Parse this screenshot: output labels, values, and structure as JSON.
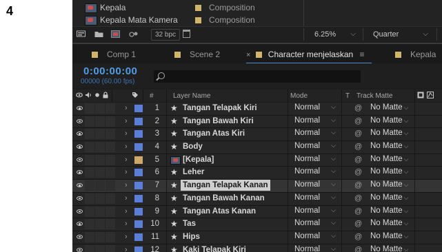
{
  "step_number": "4",
  "project": {
    "items": [
      {
        "name": "Kepala",
        "type": "Composition"
      },
      {
        "name": "Kepala Mata Kamera",
        "type": "Composition"
      }
    ],
    "bpc": "32 bpc",
    "zoom": "6.25%",
    "quality": "Quarter"
  },
  "tabs": [
    {
      "label": "Comp 1",
      "active": false
    },
    {
      "label": "Scene 2",
      "active": false
    },
    {
      "label": "Character menjelaskan",
      "active": true
    },
    {
      "label": "Kepala",
      "active": false
    }
  ],
  "timeline": {
    "timecode": "0:00:00:00",
    "frames": "00000 (60.00 fps)"
  },
  "columns": {
    "hash": "#",
    "layer_name": "Layer Name",
    "mode": "Mode",
    "t": "T",
    "track_matte": "Track Matte"
  },
  "layers": [
    {
      "num": "1",
      "name": "Tangan Telapak Kiri",
      "mode": "Normal",
      "matte": "No Matte",
      "kind": "shape",
      "label_color": "blue",
      "selected": false
    },
    {
      "num": "2",
      "name": "Tangan Bawah Kiri",
      "mode": "Normal",
      "matte": "No Matte",
      "kind": "shape",
      "label_color": "blue",
      "selected": false
    },
    {
      "num": "3",
      "name": "Tangan Atas Kiri",
      "mode": "Normal",
      "matte": "No Matte",
      "kind": "shape",
      "label_color": "blue",
      "selected": false
    },
    {
      "num": "4",
      "name": "Body",
      "mode": "Normal",
      "matte": "No Matte",
      "kind": "shape",
      "label_color": "blue",
      "selected": false
    },
    {
      "num": "5",
      "name": "[Kepala]",
      "mode": "Normal",
      "matte": "No Matte",
      "kind": "precomp",
      "label_color": "tan",
      "selected": false
    },
    {
      "num": "6",
      "name": "Leher",
      "mode": "Normal",
      "matte": "No Matte",
      "kind": "shape",
      "label_color": "blue",
      "selected": false
    },
    {
      "num": "7",
      "name": "Tangan Telapak Kanan",
      "mode": "Normal",
      "matte": "No Matte",
      "kind": "shape",
      "label_color": "blue",
      "selected": true
    },
    {
      "num": "8",
      "name": "Tangan Bawah Kanan",
      "mode": "Normal",
      "matte": "No Matte",
      "kind": "shape",
      "label_color": "blue",
      "selected": false
    },
    {
      "num": "9",
      "name": "Tangan Atas Kanan",
      "mode": "Normal",
      "matte": "No Matte",
      "kind": "shape",
      "label_color": "blue",
      "selected": false
    },
    {
      "num": "10",
      "name": "Tas",
      "mode": "Normal",
      "matte": "No Matte",
      "kind": "shape",
      "label_color": "blue",
      "selected": false
    },
    {
      "num": "11",
      "name": "Hips",
      "mode": "Normal",
      "matte": "No Matte",
      "kind": "shape",
      "label_color": "blue",
      "selected": false
    },
    {
      "num": "12",
      "name": "Kaki Telapak Kiri",
      "mode": "Normal",
      "matte": "No Matte",
      "kind": "shape",
      "label_color": "blue",
      "selected": false
    }
  ],
  "colors": {
    "accent_blue": "#4f9de6",
    "label_blue": "#5b7fd8",
    "label_tan": "#cba96a",
    "composition_swatch": "#d2b56d"
  }
}
